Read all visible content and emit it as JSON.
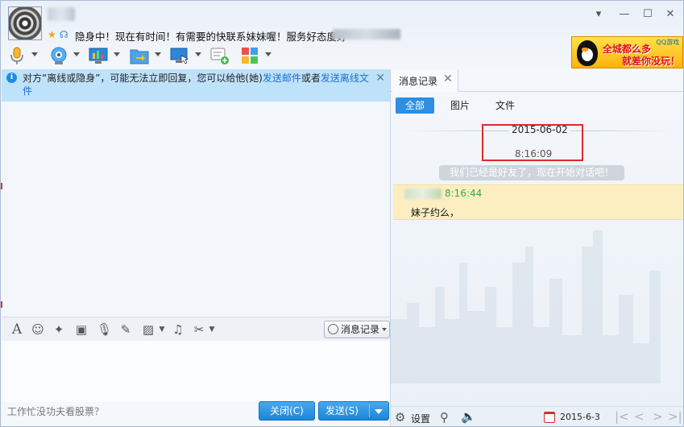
{
  "header": {
    "signature": "隐身中！现在有时间！有需要的快联系妹妹喔！服务好态度好"
  },
  "window_controls": {
    "menu_icon": "chevron-down-icon",
    "minimize": "minimize-icon",
    "maximize": "maximize-icon",
    "close": "close-icon"
  },
  "toolbar": {
    "items": [
      "microphone-icon",
      "video-icon",
      "screen-share-icon",
      "file-transfer-icon",
      "remote-desktop-icon",
      "new-message-icon",
      "apps-icon"
    ]
  },
  "ad": {
    "brand": "QQ游戏",
    "line1": "全城都么多",
    "line2": "就差你没玩！"
  },
  "notice": {
    "text_before": "对方“离线或隐身”，可能无法立即回复，您可以给他(她)",
    "link1": "发送邮件",
    "text_mid": "或者",
    "link2": "发送离线文件"
  },
  "edit_toolbar": {
    "history_label": "消息记录"
  },
  "footer": {
    "status_text": "工作忙没功夫看股票？",
    "close_label": "关闭(C)",
    "send_label": "发送(S)"
  },
  "right_panel": {
    "tab_label": "消息记录",
    "filters": [
      "全部",
      "图片",
      "文件"
    ],
    "active_filter": "全部",
    "date": "2015-06-02",
    "time": "8:16:09",
    "system_message": "我们已经是好友了，现在开始对话吧！",
    "message": {
      "time": "8:16:44",
      "content": "妹子约么，"
    },
    "footer": {
      "settings_label": "设置",
      "date": "2015-6-3"
    }
  },
  "colors": {
    "accent": "#2d8fe4",
    "notice_bg": "#bfe2fb",
    "highlight_box": "#e0282c",
    "message_bg": "#fdeec2",
    "message_time": "#3aa84b"
  }
}
